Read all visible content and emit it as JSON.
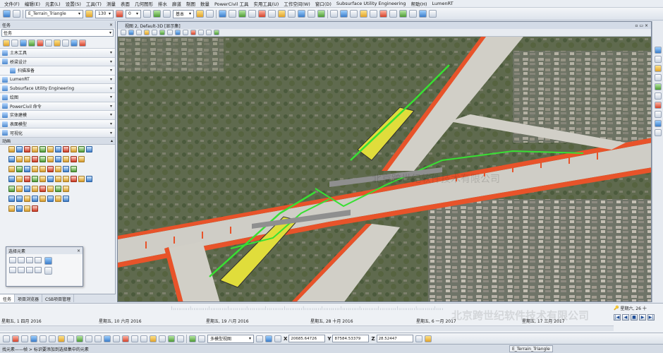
{
  "menu": [
    "文件(F)",
    "编辑(E)",
    "元素(L)",
    "设置(S)",
    "工具(T)",
    "测量",
    "表面",
    "几何图形",
    "排水",
    "廊道",
    "制图",
    "数量",
    "PowerCivil 工具",
    "实用工具(U)",
    "工作空间(W)",
    "窗口(D)",
    "Subsurface Utility Engineering",
    "帮助(H)",
    "LumenRT"
  ],
  "toolbar": {
    "model_combo": "E_Terrain_Triangle",
    "level_value": "130",
    "weight_value": "0",
    "style_value": "基本",
    "icons": [
      "open-icon",
      "save-icon",
      "undo-icon",
      "redo-icon",
      "level-icon",
      "color-icon",
      "line-weight-icon",
      "line-style-icon",
      "render-icon",
      "camera-icon",
      "light-icon",
      "print-icon",
      "help-icon"
    ]
  },
  "leftpanel": {
    "title": "任务",
    "combo": "任务",
    "tasks": [
      {
        "label": "土木工具",
        "sub": false
      },
      {
        "label": "桥梁设计",
        "sub": false
      },
      {
        "label": "扫描准备",
        "sub": true
      },
      {
        "label": "LumenRT",
        "sub": false
      },
      {
        "label": "Subsurface Utility Engineering",
        "sub": false
      },
      {
        "label": "绘图",
        "sub": false
      },
      {
        "label": "PowerCivil 命令",
        "sub": false
      },
      {
        "label": "实体建模",
        "sub": false
      },
      {
        "label": "表面模型",
        "sub": false
      },
      {
        "label": "可视化",
        "sub": false
      }
    ],
    "anim_head": "动画",
    "tabs": [
      "任务",
      "项目浏览器",
      "CSB项目管理"
    ]
  },
  "popup": {
    "title": "选择元素"
  },
  "view": {
    "title": "视图 2, Default-3D [显示集]"
  },
  "timeline": {
    "dates": [
      "星期五, 1 四月 2016",
      "星期五, 10 六月 2016",
      "星期五, 19 八月 2016",
      "星期五, 28 十月 2016",
      "星期五, 6 一月 2017",
      "星期五, 17 三月 2017"
    ],
    "speed_label": "星期六, 26 十",
    "play_icons": [
      "|◀",
      "◀",
      "■",
      "▶",
      "▶|"
    ]
  },
  "snapbar": {
    "view_combo": "多模型视图",
    "x_label": "X",
    "x_value": "20685.64726",
    "y_label": "Y",
    "y_value": "87584.53379",
    "z_label": "Z",
    "z_value": "28.52447"
  },
  "status": {
    "prompt": "找元素——帧 > 标识要添加到选择集中的元素",
    "model": "E_Terrain_Triangle"
  },
  "watermark": "北京跨世纪软件技术有限公司"
}
